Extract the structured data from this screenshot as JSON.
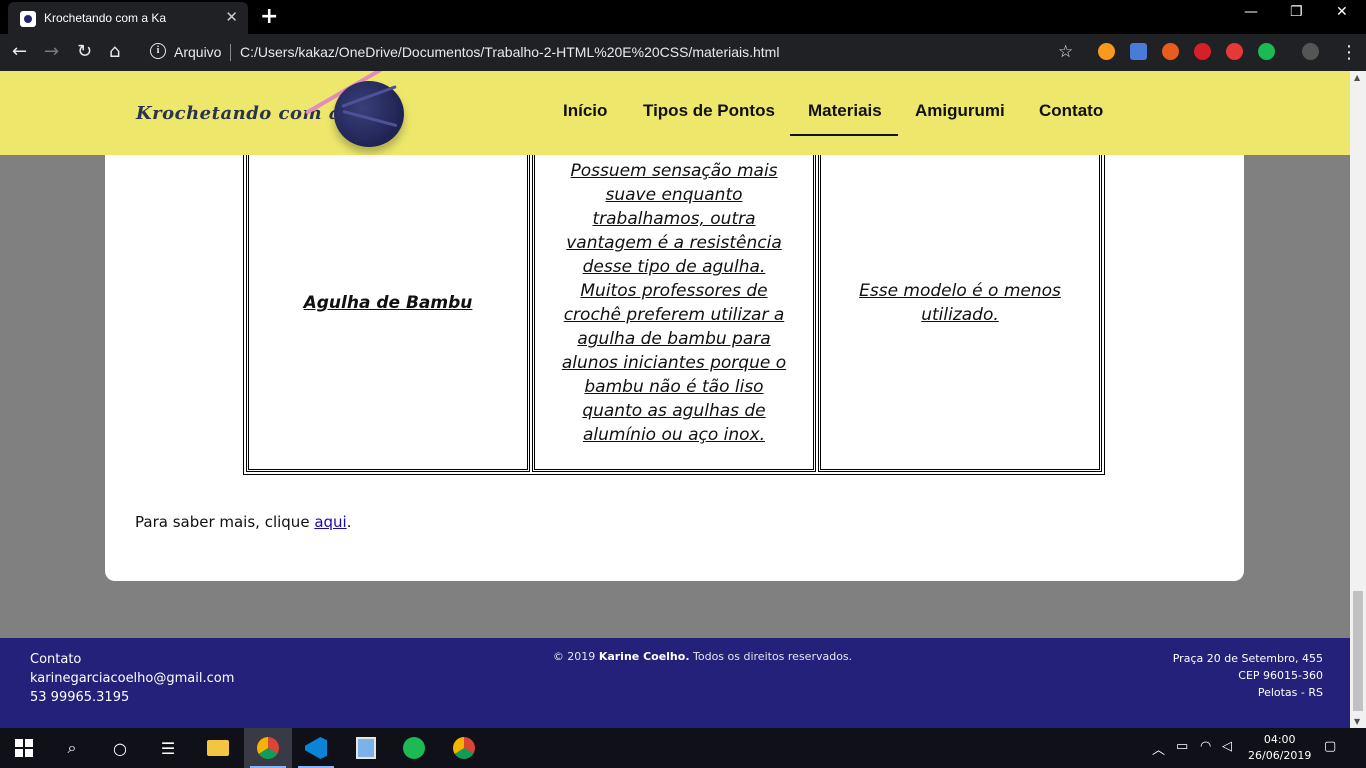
{
  "browser": {
    "tab_title": "Krochetando com a Ka",
    "address_prefix": "Arquivo",
    "url": "C:/Users/kakaz/OneDrive/Documentos/Trabalho-2-HTML%20E%20CSS/materiais.html"
  },
  "site": {
    "logo_text": "Krochetando com a Ka",
    "nav": [
      "Início",
      "Tipos de Pontos",
      "Materiais",
      "Amigurumi",
      "Contato"
    ],
    "active_nav": "Materiais"
  },
  "table": {
    "name": "Agulha de Bambu",
    "description": "Possuem sensação mais suave enquanto trabalhamos, outra vantagem é a resistência desse tipo de agulha. Muitos professores de crochê preferem utilizar a agulha de bambu para alunos iniciantes porque o bambu não é tão liso quanto as agulhas de alumínio ou aço inox.",
    "note": "Esse modelo é o menos utilizado."
  },
  "more": {
    "text": "Para saber mais, clique ",
    "link": "aqui",
    "end": "."
  },
  "footer": {
    "contact_label": "Contato",
    "email": "karinegarciacoelho@gmail.com",
    "phone": "53 99965.3195",
    "copyright_prefix": "© 2019 ",
    "copyright_name": "Karine Coelho.",
    "copyright_suffix": " Todos os direitos reservados.",
    "address1": "Praça 20 de Setembro, 455",
    "address2": "CEP 96015-360",
    "address3": "Pelotas - RS"
  },
  "taskbar": {
    "time": "04:00",
    "date": "26/06/2019"
  },
  "colors": {
    "header_bg": "#ede76b",
    "footer_bg": "#23217a",
    "page_bg": "#808080"
  }
}
